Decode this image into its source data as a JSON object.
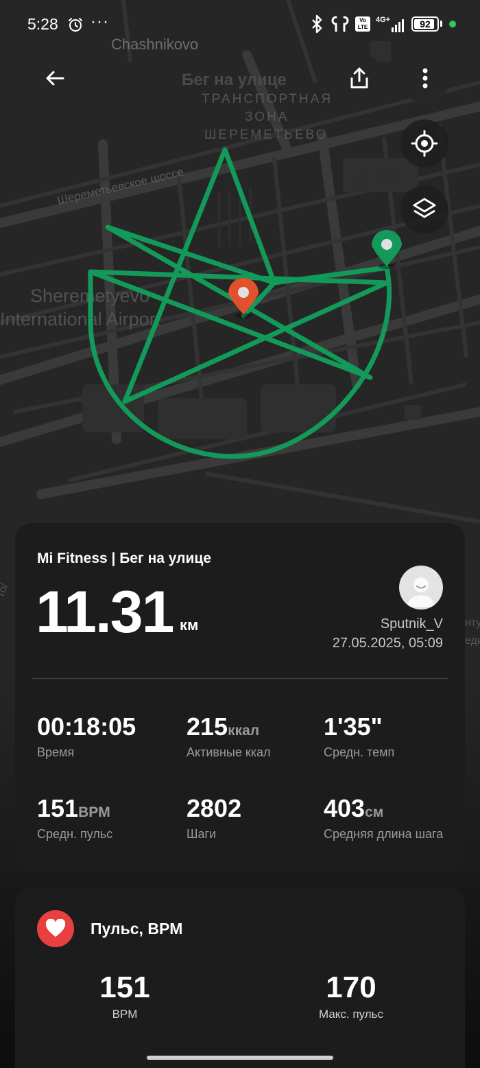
{
  "status_bar": {
    "time": "5:28",
    "overflow": "···",
    "volte_label": "Vo LTE",
    "signal_label": "4G+",
    "battery_percent": "92",
    "battery_level": 0.92,
    "dot_color": "#34c759"
  },
  "map": {
    "labels": {
      "village": "Chashnikovo",
      "title": "Бег на улице",
      "zone_line1": "ТРАНСПОРТНАЯ",
      "zone_line2": "ЗОНА",
      "zone_line3": "ШЕРЕМЕТЬЕВО",
      "road": "Шереметьевское шоссе",
      "airport_line1": "Sheremetyevo",
      "airport_line2": "International Airport",
      "edge_left": "ro/",
      "edge_right1": "нту",
      "edge_right2": "еди"
    },
    "route_color": "#139a5a",
    "start_pin_color": "#139a5a",
    "end_pin_color": "#e2512c"
  },
  "icons": {
    "back": "arrow-left-icon",
    "share": "share-icon",
    "more": "more-vertical-icon",
    "locate": "crosshair-icon",
    "layers": "layers-icon",
    "heart": "heart-icon",
    "alarm": "alarm-clock-icon"
  },
  "workout": {
    "title": "Mi Fitness | Бег на улице",
    "distance": "11.31",
    "distance_unit": "км",
    "username": "Sputnik_V",
    "datetime": "27.05.2025, 05:09",
    "stats": [
      {
        "value": "00:18:05",
        "unit": "",
        "label": "Время"
      },
      {
        "value": "215",
        "unit": "ккал",
        "label": "Активные ккал"
      },
      {
        "value": "1'35\"",
        "unit": "",
        "label": "Средн. темп"
      },
      {
        "value": "151",
        "unit": "BPM",
        "label": "Средн. пульс"
      },
      {
        "value": "2802",
        "unit": "",
        "label": "Шаги"
      },
      {
        "value": "403",
        "unit": "см",
        "label": "Средняя длина шага"
      }
    ]
  },
  "heart_rate": {
    "title": "Пульс, BPM",
    "accent": "#e8403f",
    "avg_value": "151",
    "avg_label": "BPM",
    "max_value": "170",
    "max_label": "Макс. пульс"
  }
}
